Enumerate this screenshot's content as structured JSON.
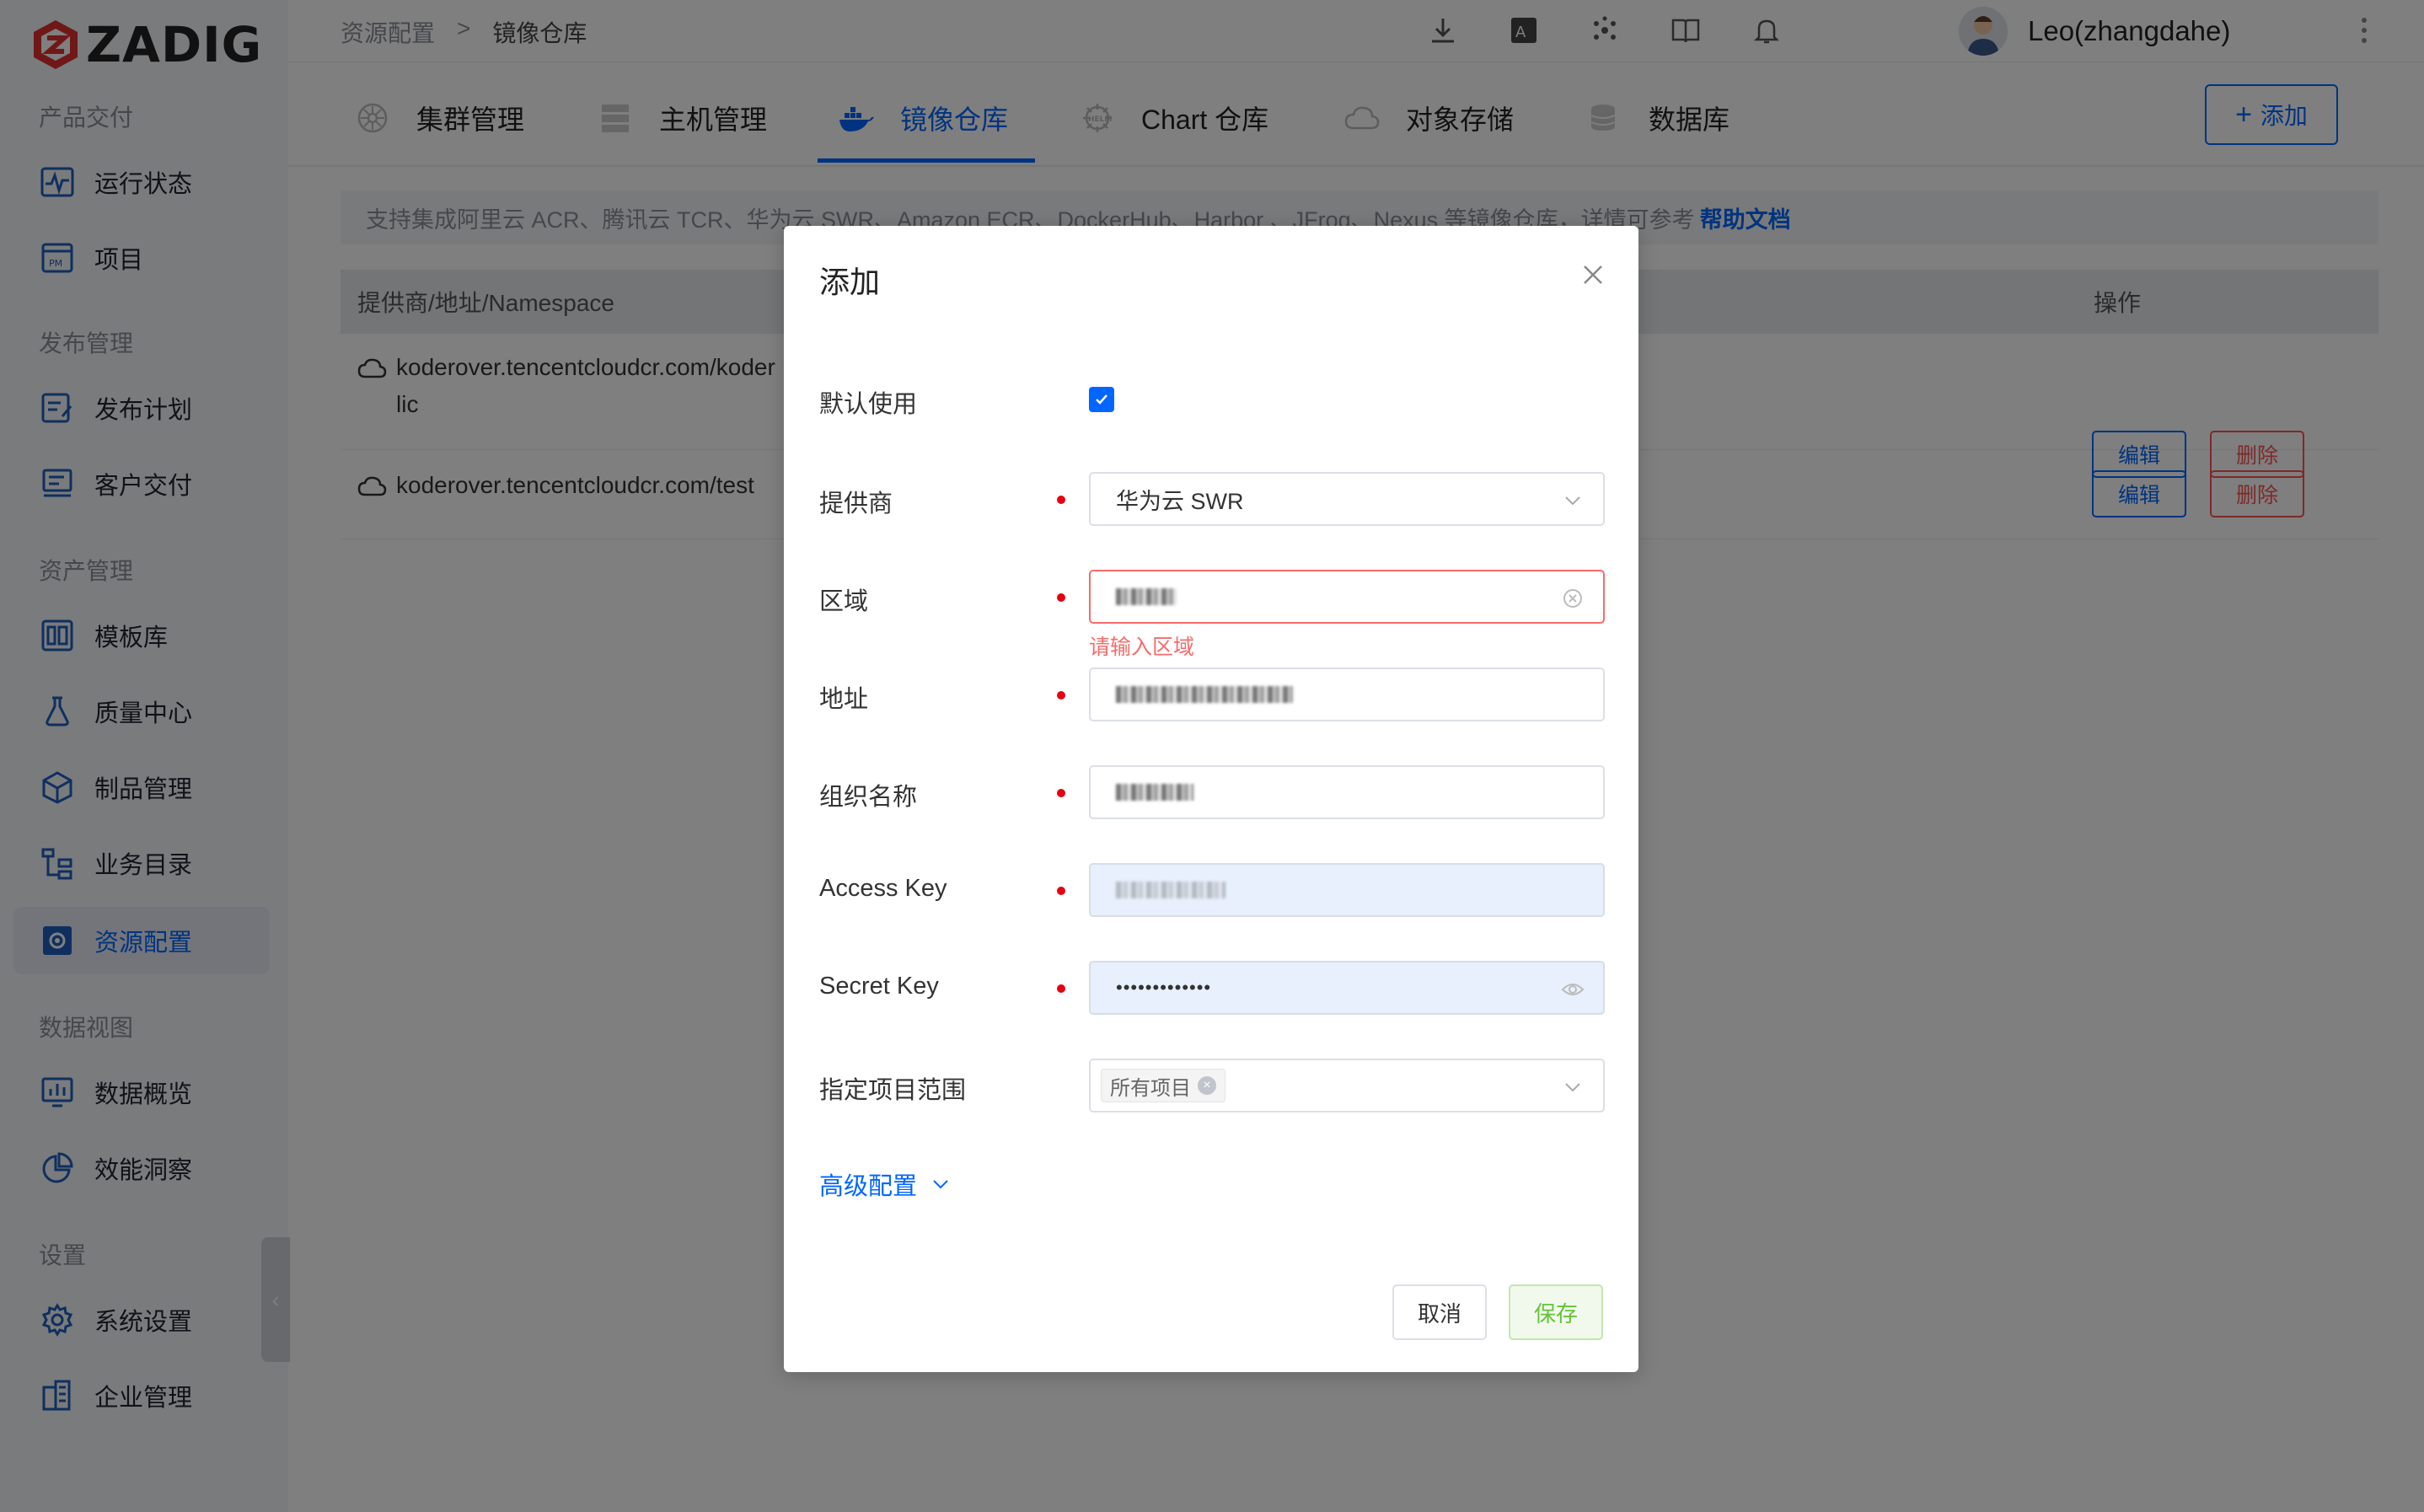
{
  "app": {
    "name": "ZADIG"
  },
  "sidebar": {
    "groups": [
      {
        "title": "产品交付",
        "items": [
          {
            "label": "运行状态",
            "icon": "pulse-icon"
          },
          {
            "label": "项目",
            "icon": "project-icon"
          }
        ]
      },
      {
        "title": "发布管理",
        "items": [
          {
            "label": "发布计划",
            "icon": "release-plan-icon"
          },
          {
            "label": "客户交付",
            "icon": "delivery-icon"
          }
        ]
      },
      {
        "title": "资产管理",
        "items": [
          {
            "label": "模板库",
            "icon": "template-icon"
          },
          {
            "label": "质量中心",
            "icon": "flask-icon"
          },
          {
            "label": "制品管理",
            "icon": "artifact-icon"
          },
          {
            "label": "业务目录",
            "icon": "catalog-icon"
          },
          {
            "label": "资源配置",
            "icon": "resource-config-icon",
            "active": true
          }
        ]
      },
      {
        "title": "数据视图",
        "items": [
          {
            "label": "数据概览",
            "icon": "chart-icon"
          },
          {
            "label": "效能洞察",
            "icon": "pie-chart-icon"
          }
        ]
      },
      {
        "title": "设置",
        "items": [
          {
            "label": "系统设置",
            "icon": "gear-icon"
          },
          {
            "label": "企业管理",
            "icon": "building-icon"
          }
        ]
      }
    ]
  },
  "breadcrumb": {
    "parent": "资源配置",
    "separator": ">",
    "current": "镜像仓库"
  },
  "user": {
    "name": "Leo(zhangdahe)"
  },
  "tabs": [
    {
      "label": "集群管理",
      "icon": "kubernetes-icon"
    },
    {
      "label": "主机管理",
      "icon": "server-icon"
    },
    {
      "label": "镜像仓库",
      "icon": "docker-icon",
      "active": true
    },
    {
      "label": "Chart 仓库",
      "icon": "helm-icon"
    },
    {
      "label": "对象存储",
      "icon": "cloud-icon"
    },
    {
      "label": "数据库",
      "icon": "database-icon"
    }
  ],
  "add_button": {
    "label": "添加"
  },
  "notice": {
    "text": "支持集成阿里云 ACR、腾讯云 TCR、华为云 SWR、Amazon ECR、DockerHub、Harbor 、JFrog、Nexus 等镜像仓库，详情可参考",
    "link": "帮助文档"
  },
  "table": {
    "headers": {
      "address": "提供商/地址/Namespace",
      "actions": "操作"
    },
    "rows": [
      {
        "address_line1": "koderover.tencentcloudcr.com/koder",
        "address_line2": "lic",
        "edit": "编辑",
        "delete": "删除"
      },
      {
        "address_line1": "koderover.tencentcloudcr.com/test",
        "edit": "编辑",
        "delete": "删除"
      }
    ]
  },
  "modal": {
    "title": "添加",
    "fields": {
      "default_use": {
        "label": "默认使用",
        "checked": true
      },
      "provider": {
        "label": "提供商",
        "value": "华为云 SWR"
      },
      "region": {
        "label": "区域",
        "error": "请输入区域"
      },
      "address": {
        "label": "地址"
      },
      "org": {
        "label": "组织名称"
      },
      "access_key": {
        "label": "Access Key"
      },
      "secret_key": {
        "label": "Secret Key",
        "value": "•••••••••••••"
      },
      "project_scope": {
        "label": "指定项目范围",
        "tag": "所有项目"
      }
    },
    "advanced": "高级配置",
    "cancel": "取消",
    "save": "保存"
  },
  "colors": {
    "primary": "#0066ff",
    "danger": "#ff5252",
    "success": "#67c23a",
    "error": "#f56c6c"
  }
}
